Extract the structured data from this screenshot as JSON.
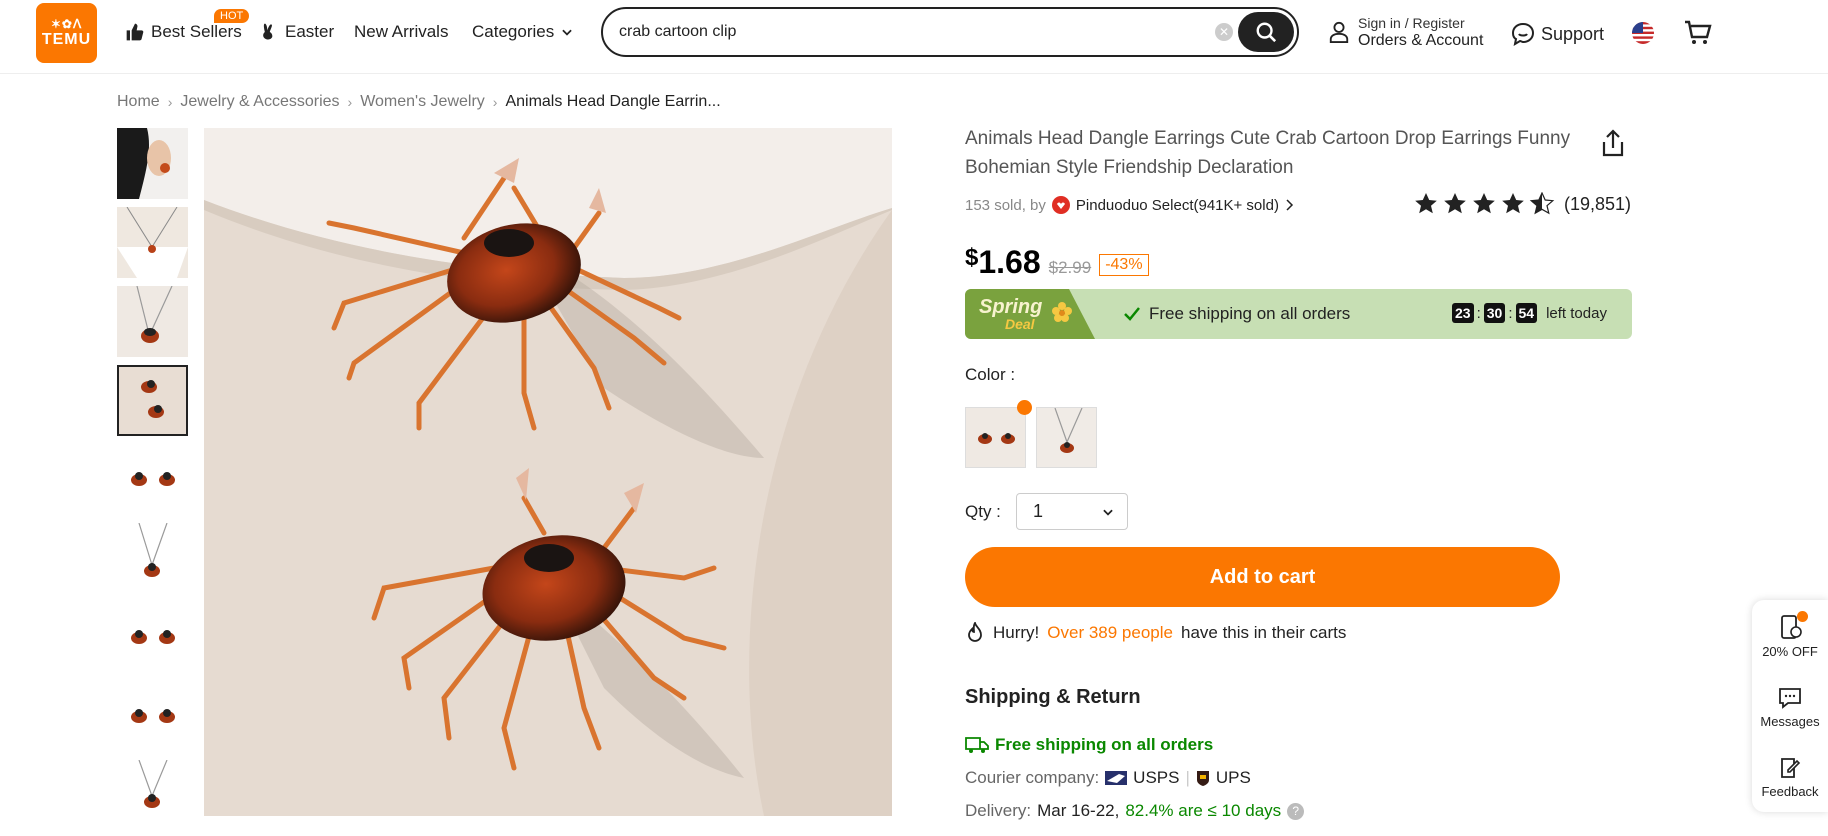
{
  "header": {
    "logo_top": "✶✿ᐱ",
    "logo_word": "TEMU",
    "nav": {
      "best_sellers": "Best Sellers",
      "hot_badge": "HOT",
      "easter": "Easter",
      "new_arrivals": "New Arrivals",
      "categories": "Categories"
    },
    "search_value": "crab cartoon clip",
    "account_line1": "Sign in / Register",
    "account_line2": "Orders & Account",
    "support": "Support"
  },
  "breadcrumb": [
    "Home",
    "Jewelry & Accessories",
    "Women's Jewelry",
    "Animals Head Dangle Earrin..."
  ],
  "product": {
    "title": "Animals Head Dangle Earrings Cute Crab Cartoon Drop Earrings Funny Bohemian Style Friendship Declaration",
    "sold_prefix": "153 sold, by",
    "store": "Pinduoduo Select(941K+ sold)",
    "rating_value": 4.5,
    "review_count": "(19,851)",
    "price_symbol": "$",
    "price": "1.68",
    "old_price": "$2.99",
    "discount": "-43%",
    "deal": {
      "badge_top": "Spring",
      "badge_bottom": "Deal",
      "text": "Free shipping on all orders",
      "timer_h": "23",
      "timer_m": "30",
      "timer_s": "54",
      "timer_suffix": "left today"
    },
    "color_label": "Color :",
    "qty_label": "Qty :",
    "qty_value": "1",
    "add_to_cart": "Add to cart",
    "hurry": {
      "prefix": "Hurry!",
      "highlight": "Over 389 people",
      "suffix": "have this in their carts"
    }
  },
  "shipping": {
    "title": "Shipping & Return",
    "free_shipping": "Free shipping on all orders",
    "courier_label": "Courier company:",
    "courier_1": "USPS",
    "courier_2": "UPS",
    "delivery_label": "Delivery:",
    "delivery_dates": "Mar 16-22,",
    "delivery_pct": "82.4% are ≤ 10 days"
  },
  "side_panel": {
    "offer": "20% OFF",
    "messages": "Messages",
    "feedback": "Feedback"
  },
  "colors": {
    "brand": "#fb7701",
    "deal_bg": "#c7dfb4",
    "free_ship_green": "#0a8800"
  }
}
